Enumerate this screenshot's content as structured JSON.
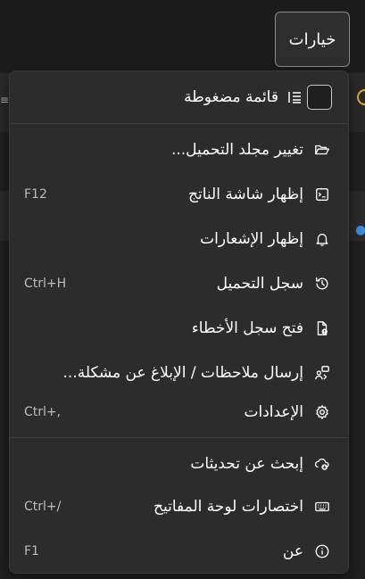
{
  "options_button": {
    "label": "خيارات"
  },
  "menu": {
    "compact": {
      "label": "قائمة مضغوطة",
      "checked": false,
      "icon": "compact-list-icon"
    },
    "items": [
      {
        "key": "change-folder",
        "label": "تغيير مجلد التحميل...",
        "shortcut": "",
        "icon": "folder-open-icon"
      },
      {
        "key": "output-screen",
        "label": "إظهار شاشة الناتج",
        "shortcut": "F12",
        "icon": "terminal-window-icon"
      },
      {
        "key": "notifications",
        "label": "إظهار الإشعارات",
        "shortcut": "",
        "icon": "bell-icon"
      },
      {
        "key": "download-log",
        "label": "سجل التحميل",
        "shortcut": "Ctrl+H",
        "icon": "history-clock-icon"
      },
      {
        "key": "error-log",
        "label": "فتح سجل الأخطاء",
        "shortcut": "",
        "icon": "error-document-icon"
      },
      {
        "key": "feedback",
        "label": "إرسال ملاحظات / الإبلاغ عن مشكلة...",
        "shortcut": "",
        "icon": "feedback-icon"
      },
      {
        "key": "settings",
        "label": "الإعدادات",
        "shortcut": "Ctrl+,",
        "icon": "gear-icon"
      }
    ],
    "items2": [
      {
        "key": "check-updates",
        "label": "إبحث عن تحديثات",
        "shortcut": "",
        "icon": "cloud-download-icon"
      },
      {
        "key": "shortcuts",
        "label": "اختصارات لوحة المفاتيح",
        "shortcut": "Ctrl+/",
        "icon": "keyboard-icon"
      },
      {
        "key": "about",
        "label": "عن",
        "shortcut": "F1",
        "icon": "info-icon"
      }
    ]
  },
  "colors": {
    "menu_bg": "#2c2c2c",
    "page_bg": "#202020",
    "text": "#ffffff",
    "shortcut": "#bdbdbd"
  }
}
